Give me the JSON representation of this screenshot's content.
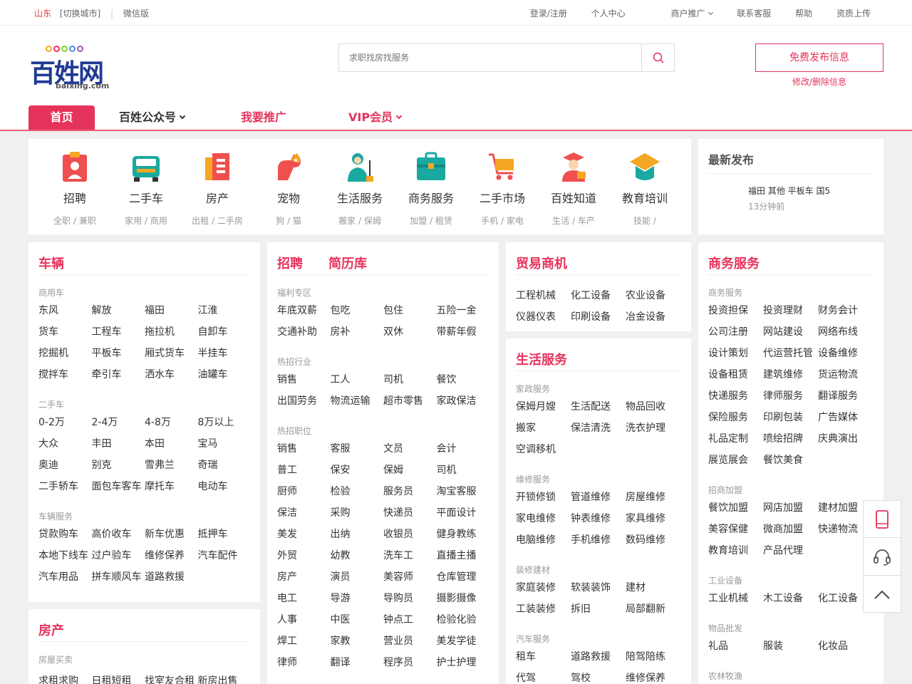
{
  "topbar": {
    "city": "山东",
    "switch_city": "[切换城市]",
    "sep": "|",
    "wechat": "微信版",
    "links": [
      "登录/注册",
      "个人中心",
      "商户推广",
      "联系客服",
      "帮助",
      "资质上传"
    ]
  },
  "logo": {
    "name": "百姓网",
    "domain": "baixing.com"
  },
  "search": {
    "placeholder": "求职找房找服务"
  },
  "publish": {
    "label": "免费发布信息",
    "modify": "修改/删除信息"
  },
  "nav": {
    "home": "首页",
    "gzh": "百姓公众号",
    "promo": "我要推广",
    "vip": "VIP会员"
  },
  "colors": {
    "accent": "#e6335c",
    "logo_blue": "#1f3a93"
  },
  "categories": [
    {
      "title": "招聘",
      "sub": "全职 / 兼职",
      "icon": "job-badge-icon"
    },
    {
      "title": "二手车",
      "sub": "家用 / 商用",
      "icon": "car-icon"
    },
    {
      "title": "房产",
      "sub": "出租 / 二手房",
      "icon": "building-icon"
    },
    {
      "title": "宠物",
      "sub": "狗 / 猫",
      "icon": "dog-icon"
    },
    {
      "title": "生活服务",
      "sub": "搬家 / 保姆",
      "icon": "cleaner-icon"
    },
    {
      "title": "商务服务",
      "sub": "加盟 / 租赁",
      "icon": "briefcase-icon"
    },
    {
      "title": "二手市场",
      "sub": "手机 / 家电",
      "icon": "cart-icon"
    },
    {
      "title": "百姓知道",
      "sub": "生活 / 车产",
      "icon": "scholar-icon"
    },
    {
      "title": "教育培训",
      "sub": "技能 /",
      "icon": "graduation-cap-icon"
    }
  ],
  "latest": {
    "title": "最新发布",
    "entry": "福田 其他 平板车 国5",
    "time": "13分钟前"
  },
  "vehicles": {
    "title": "车辆",
    "sections": [
      {
        "label": "商用车",
        "items": [
          "东风",
          "解放",
          "福田",
          "江淮",
          "货车",
          "工程车",
          "拖拉机",
          "自卸车",
          "挖掘机",
          "平板车",
          "厢式货车",
          "半挂车",
          "搅拌车",
          "牵引车",
          "洒水车",
          "油罐车"
        ]
      },
      {
        "label": "二手车",
        "items": [
          "0-2万",
          "2-4万",
          "4-8万",
          "8万以上",
          "大众",
          "丰田",
          "本田",
          "宝马",
          "奥迪",
          "别克",
          "雪弗兰",
          "奇瑞",
          "二手轿车",
          "面包车客车",
          "摩托车",
          "电动车"
        ]
      },
      {
        "label": "车辆服务",
        "items": [
          "贷款购车",
          "高价收车",
          "新车优惠",
          "抵押车",
          "本地下线车",
          "过户验车",
          "维修保养",
          "汽车配件",
          "汽车用品",
          "拼车顺风车",
          "道路救援"
        ]
      }
    ]
  },
  "realestate": {
    "title": "房产",
    "section": "房屋买卖",
    "items": [
      "求租求购",
      "日租短租",
      "找室友合租",
      "新房出售"
    ]
  },
  "jobs": {
    "title": "招聘",
    "title2": "简历库",
    "sections": [
      {
        "label": "福利专区",
        "items": [
          "年底双薪",
          "包吃",
          "包住",
          "五险一金",
          "交通补助",
          "房补",
          "双休",
          "带薪年假"
        ]
      },
      {
        "label": "热招行业",
        "items": [
          "销售",
          "工人",
          "司机",
          "餐饮",
          "出国劳务",
          "物流运输",
          "超市零售",
          "家政保洁"
        ]
      },
      {
        "label": "热招职位",
        "items": [
          "销售",
          "客服",
          "文员",
          "会计",
          "普工",
          "保安",
          "保姆",
          "司机",
          "厨师",
          "检验",
          "服务员",
          "淘宝客服",
          "保洁",
          "采购",
          "快递员",
          "平面设计",
          "美发",
          "出纳",
          "收银员",
          "健身教练",
          "外贸",
          "幼教",
          "洗车工",
          "直播主播",
          "房产",
          "演员",
          "美容师",
          "仓库管理",
          "电工",
          "导游",
          "导购员",
          "摄影摄像",
          "人事",
          "中医",
          "钟点工",
          "检验化验",
          "焊工",
          "家教",
          "营业员",
          "美发学徒",
          "律师",
          "翻译",
          "程序员",
          "护士护理"
        ]
      }
    ]
  },
  "trade": {
    "title": "贸易商机",
    "items": [
      "工程机械",
      "化工设备",
      "农业设备",
      "仪器仪表",
      "印刷设备",
      "冶金设备"
    ]
  },
  "life": {
    "title": "生活服务",
    "sections": [
      {
        "label": "家政服务",
        "items": [
          "保姆月嫂",
          "生活配送",
          "物品回收",
          "搬家",
          "保洁清洗",
          "洗衣护理",
          "空调移机"
        ]
      },
      {
        "label": "维修服务",
        "items": [
          "开锁修锁",
          "管道维修",
          "房屋维修",
          "家电维修",
          "钟表维修",
          "家具维修",
          "电脑维修",
          "手机维修",
          "数码维修"
        ]
      },
      {
        "label": "装修建材",
        "items": [
          "家庭装修",
          "软装装饰",
          "建材",
          "工装装修",
          "拆旧",
          "局部翻新"
        ]
      },
      {
        "label": "汽车服务",
        "items": [
          "租车",
          "道路救援",
          "陪驾陪练",
          "代驾",
          "驾校",
          "维修保养"
        ]
      }
    ]
  },
  "business": {
    "title": "商务服务",
    "sections": [
      {
        "label": "商务服务",
        "items": [
          "投资担保",
          "投资理财",
          "财务会计",
          "公司注册",
          "网站建设",
          "网络布线",
          "设计策划",
          "代运营托管",
          "设备维修",
          "设备租赁",
          "建筑维修",
          "货运物流",
          "快递服务",
          "律师服务",
          "翻译服务",
          "保险服务",
          "印刷包装",
          "广告媒体",
          "礼品定制",
          "喷绘招牌",
          "庆典演出",
          "展览展会",
          "餐饮美食"
        ]
      },
      {
        "label": "招商加盟",
        "items": [
          "餐饮加盟",
          "网店加盟",
          "建材加盟",
          "美容保健",
          "微商加盟",
          "快递物流",
          "教育培训",
          "产品代理"
        ]
      },
      {
        "label": "工业设备",
        "items": [
          "工业机械",
          "木工设备",
          "化工设备"
        ]
      },
      {
        "label": "物品批发",
        "items": [
          "礼品",
          "服装",
          "化妆品"
        ]
      },
      {
        "label": "农林牧渔",
        "items": []
      }
    ]
  },
  "side_tools": [
    "tablet-icon",
    "headset-icon",
    "back-to-top-icon"
  ]
}
